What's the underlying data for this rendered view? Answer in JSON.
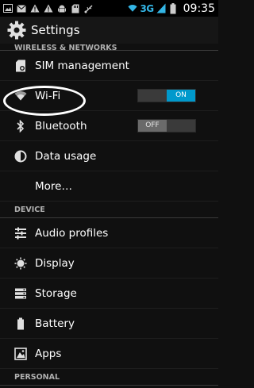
{
  "status_bar": {
    "network_type": "3G",
    "time": "09:35",
    "icons": [
      "image-icon",
      "email-icon",
      "warning-icon",
      "warning-icon",
      "android-icon",
      "sd-card-icon",
      "usb-icon",
      "signal-icon",
      "battery-icon"
    ],
    "accent_color": "#33b5e5"
  },
  "action_bar": {
    "title": "Settings",
    "icon": "gear-icon"
  },
  "sections": {
    "wireless": "WIRELESS & NETWORKS",
    "device": "DEVICE",
    "personal": "PERSONAL"
  },
  "items": {
    "sim": {
      "label": "SIM management",
      "icon": "sim-icon"
    },
    "wifi": {
      "label": "Wi-Fi",
      "icon": "wifi-icon",
      "toggle": "ON"
    },
    "bluetooth": {
      "label": "Bluetooth",
      "icon": "bluetooth-icon",
      "toggle": "OFF"
    },
    "data_usage": {
      "label": "Data usage",
      "icon": "data-usage-icon"
    },
    "more": {
      "label": "More…"
    },
    "audio": {
      "label": "Audio profiles",
      "icon": "audio-profiles-icon"
    },
    "display": {
      "label": "Display",
      "icon": "display-icon"
    },
    "storage": {
      "label": "Storage",
      "icon": "storage-icon"
    },
    "battery": {
      "label": "Battery",
      "icon": "battery-icon"
    },
    "apps": {
      "label": "Apps",
      "icon": "apps-icon"
    }
  },
  "toggle_on_color": "#0099cc"
}
